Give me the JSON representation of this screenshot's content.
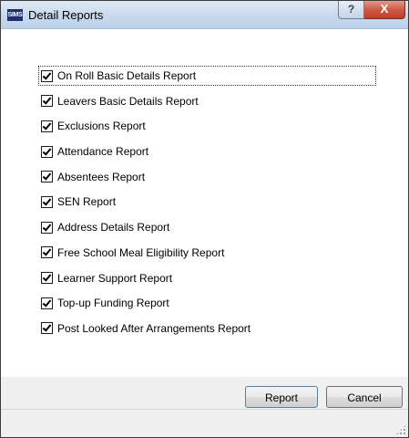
{
  "window": {
    "app_icon_text": "SIMS",
    "title": "Detail Reports",
    "help_glyph": "?",
    "close_glyph": "X"
  },
  "reports": [
    {
      "label": "On Roll Basic Details Report",
      "checked": true
    },
    {
      "label": "Leavers Basic Details Report",
      "checked": true
    },
    {
      "label": "Exclusions Report",
      "checked": true
    },
    {
      "label": "Attendance Report",
      "checked": true
    },
    {
      "label": "Absentees Report",
      "checked": true
    },
    {
      "label": "SEN Report",
      "checked": true
    },
    {
      "label": "Address Details Report",
      "checked": true
    },
    {
      "label": "Free School Meal Eligibility Report",
      "checked": true
    },
    {
      "label": "Learner Support Report",
      "checked": true
    },
    {
      "label": "Top-up Funding Report",
      "checked": true
    },
    {
      "label": "Post Looked After Arrangements Report",
      "checked": true
    }
  ],
  "buttons": {
    "report_label": "Report",
    "cancel_label": "Cancel"
  },
  "colors": {
    "close_button": "#c13d28",
    "titlebar": "#c8d9ee",
    "content_bg": "#ffffff",
    "footer_bg": "#f0f0f0"
  },
  "icons": {
    "app": "sims-app-icon",
    "help": "help-icon",
    "close": "close-icon",
    "checkbox": "checkbox-checked-icon",
    "resize": "resize-grip-icon"
  }
}
